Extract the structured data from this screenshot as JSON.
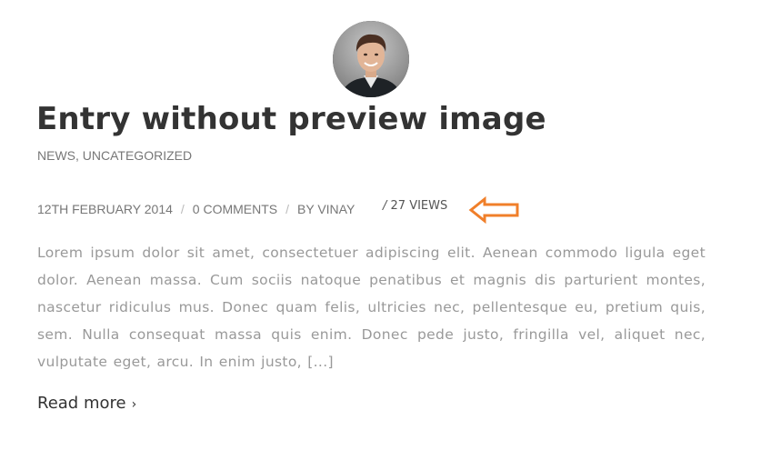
{
  "post": {
    "title": "Entry without preview image",
    "categories": [
      "NEWS",
      "UNCATEGORIZED"
    ],
    "category_separator": ", ",
    "date": "12TH FEBRUARY 2014",
    "comments": "0 COMMENTS",
    "author": "BY VINAY",
    "meta_separator": "/",
    "views_slash": "/",
    "views": "27 VIEWS",
    "excerpt": "Lorem ipsum dolor sit amet, consectetuer adipiscing elit. Aenean commodo ligula eget dolor. Aenean massa. Cum sociis natoque penatibus et magnis dis parturient montes, nascetur ridiculus mus. Donec quam felis, ultricies nec, pellentesque eu, pretium quis, sem. Nulla consequat massa quis enim. Donec pede justo, fringilla vel, aliquet nec, vulputate eget, arcu. In enim justo, [...]",
    "read_more": "Read more",
    "read_more_chevron": "›"
  },
  "icons": {
    "avatar": "author-avatar-photo",
    "annotation_arrow": "left-arrow-icon"
  },
  "colors": {
    "title": "#333333",
    "meta": "#777777",
    "excerpt": "#999999",
    "arrow": "#f07f2a"
  }
}
